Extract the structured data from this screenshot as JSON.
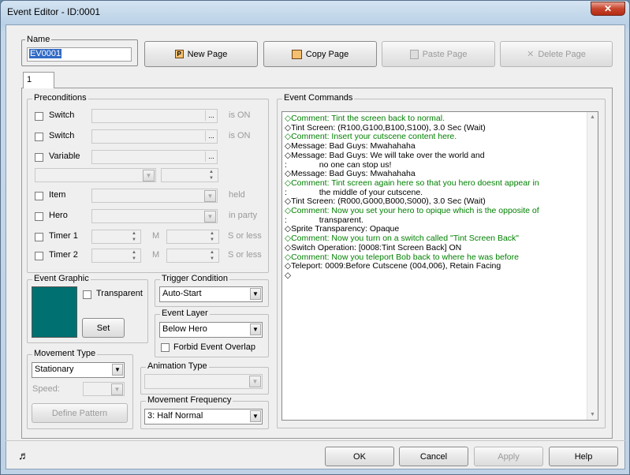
{
  "window": {
    "title": "Event Editor - ID:0001",
    "close_icon": "close-icon"
  },
  "name_group": {
    "label": "Name",
    "value": "EV0001"
  },
  "page_buttons": {
    "new_page": "New Page",
    "copy_page": "Copy Page",
    "paste_page": "Paste Page",
    "delete_page": "Delete Page"
  },
  "tabs": [
    {
      "label": "1"
    }
  ],
  "preconditions": {
    "label": "Preconditions",
    "switch1": "Switch",
    "switch1_state": "is ON",
    "switch2": "Switch",
    "switch2_state": "is ON",
    "variable": "Variable",
    "item": "Item",
    "item_state": "held",
    "hero": "Hero",
    "hero_state": "in party",
    "timer1": "Timer 1",
    "timer1_m": "M",
    "timer1_state": "S or less",
    "timer2": "Timer 2",
    "timer2_m": "M",
    "timer2_state": "S or less",
    "dots": "..."
  },
  "event_graphic": {
    "label": "Event Graphic",
    "transparent": "Transparent",
    "set": "Set",
    "color": "#007070"
  },
  "trigger": {
    "label": "Trigger Condition",
    "value": "Auto-Start"
  },
  "event_layer": {
    "label": "Event Layer",
    "value": "Below Hero",
    "forbid": "Forbid Event Overlap"
  },
  "movement_type": {
    "label": "Movement Type",
    "value": "Stationary",
    "speed": "Speed:",
    "define_pattern": "Define Pattern"
  },
  "animation_type": {
    "label": "Animation Type",
    "value": ""
  },
  "movement_frequency": {
    "label": "Movement Frequency",
    "value": "3: Half Normal"
  },
  "event_commands": {
    "label": "Event Commands",
    "lines": [
      {
        "text": "◇Comment: Tint the screen back to normal.",
        "comment": true
      },
      {
        "text": "◇Tint Screen: (R100,G100,B100,S100), 3.0 Sec (Wait)",
        "comment": false
      },
      {
        "text": "◇Comment: Insert your cutscene content here.",
        "comment": true
      },
      {
        "text": "◇Message: Bad Guys: Mwahahaha",
        "comment": false
      },
      {
        "text": "◇Message: Bad Guys: We will take over the world and",
        "comment": false
      },
      {
        "text": ":              no one can stop us!",
        "comment": false
      },
      {
        "text": "◇Message: Bad Guys: Mwahahaha",
        "comment": false
      },
      {
        "text": "◇Comment: Tint screen again here so that you hero doesnt appear in",
        "comment": true
      },
      {
        "text": ":              the middle of your cutscene.",
        "comment": false
      },
      {
        "text": "◇Tint Screen: (R000,G000,B000,S000), 3.0 Sec (Wait)",
        "comment": false
      },
      {
        "text": "◇Comment: Now you set your hero to opique which is the opposite of",
        "comment": true
      },
      {
        "text": ":              transparent.",
        "comment": false
      },
      {
        "text": "◇Sprite Transparency: Opaque",
        "comment": false
      },
      {
        "text": "◇Comment: Now you turn on a switch called \"Tint Screen Back\"",
        "comment": true
      },
      {
        "text": "◇Switch Operation: [0008:Tint Screen Back] ON",
        "comment": false
      },
      {
        "text": "◇Comment: Now you teleport Bob back to where he was before",
        "comment": true
      },
      {
        "text": "◇Teleport: 0009:Before Cutscene (004,006), Retain Facing",
        "comment": false
      },
      {
        "text": "◇",
        "comment": false
      }
    ]
  },
  "bottom_buttons": {
    "ok": "OK",
    "cancel": "Cancel",
    "apply": "Apply",
    "help": "Help"
  },
  "status": {
    "music_icon": "music-note-icon"
  }
}
